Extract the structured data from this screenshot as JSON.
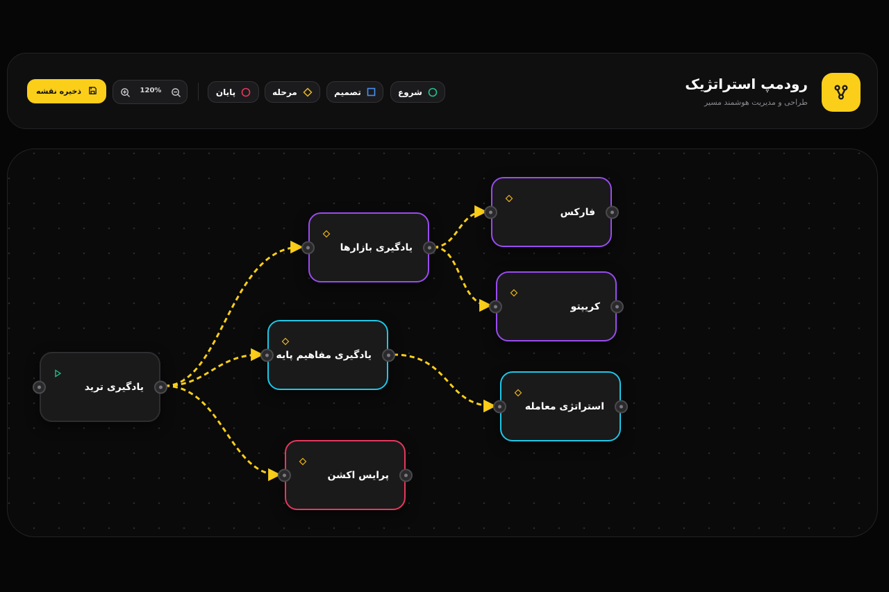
{
  "header": {
    "title": "رودمپ استراتژیک",
    "subtitle": "طراحی و مدیریت هوشمند مسیر",
    "brand_icon": "share-nodes-icon",
    "legend": [
      {
        "label": "شروع",
        "icon": "circle-icon",
        "color": "#22c48a"
      },
      {
        "label": "تصمیم",
        "icon": "square-icon",
        "color": "#4a8ff0"
      },
      {
        "label": "مرحله",
        "icon": "diamond-icon",
        "color": "#f0b81a"
      },
      {
        "label": "پایان",
        "icon": "circle-icon",
        "color": "#e8375c"
      }
    ],
    "zoom": {
      "value": "120%",
      "zoom_in_icon": "zoom-in-icon",
      "zoom_out_icon": "zoom-out-icon"
    },
    "save_label": "ذخیره نقشه",
    "save_icon": "save-icon"
  },
  "colors": {
    "accent": "#fbcf19",
    "edge": "#fbcf19",
    "start": "#22c48a",
    "step": "#f0b81a",
    "purple": "#9a4cf0",
    "cyan": "#1ec8e8",
    "red": "#e8375c"
  },
  "nodes": [
    {
      "id": "learn-trade",
      "label": "یادگیری ترید",
      "type": "start",
      "icon": "play-icon"
    },
    {
      "id": "learn-markets",
      "label": "یادگیری بازارها",
      "type": "step",
      "icon": "diamond-icon"
    },
    {
      "id": "learn-basics",
      "label": "یادگیری مفاهیم پایه",
      "type": "step",
      "icon": "diamond-icon"
    },
    {
      "id": "price-action",
      "label": "پرایس اکشن",
      "type": "step",
      "icon": "diamond-icon"
    },
    {
      "id": "forex",
      "label": "فارکس",
      "type": "step",
      "icon": "diamond-icon"
    },
    {
      "id": "crypto",
      "label": "کریپتو",
      "type": "step",
      "icon": "diamond-icon"
    },
    {
      "id": "trading-strategy",
      "label": "استراتژی معامله",
      "type": "step",
      "icon": "diamond-icon"
    }
  ],
  "edges": [
    {
      "from": "learn-trade",
      "to": "learn-markets"
    },
    {
      "from": "learn-trade",
      "to": "learn-basics"
    },
    {
      "from": "learn-trade",
      "to": "price-action"
    },
    {
      "from": "learn-markets",
      "to": "forex"
    },
    {
      "from": "learn-markets",
      "to": "crypto"
    },
    {
      "from": "learn-basics",
      "to": "trading-strategy"
    }
  ]
}
